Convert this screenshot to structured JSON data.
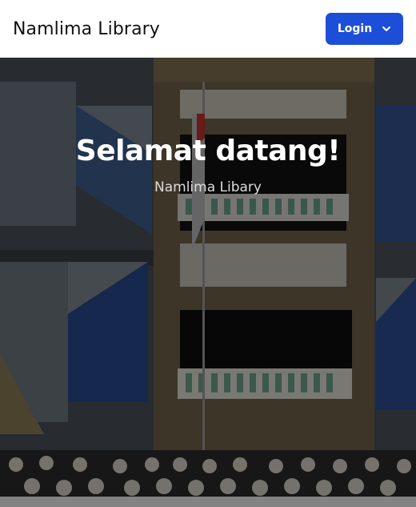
{
  "navbar": {
    "brand": "Namlima Library",
    "login_label": "Login"
  },
  "hero": {
    "title": "Selamat datang!",
    "subtitle": "Namlima Libary"
  },
  "colors": {
    "accent": "#1d4ed8",
    "navbar_bg": "#ffffff"
  },
  "icons": {
    "login_dropdown": "chevron-down-icon"
  }
}
